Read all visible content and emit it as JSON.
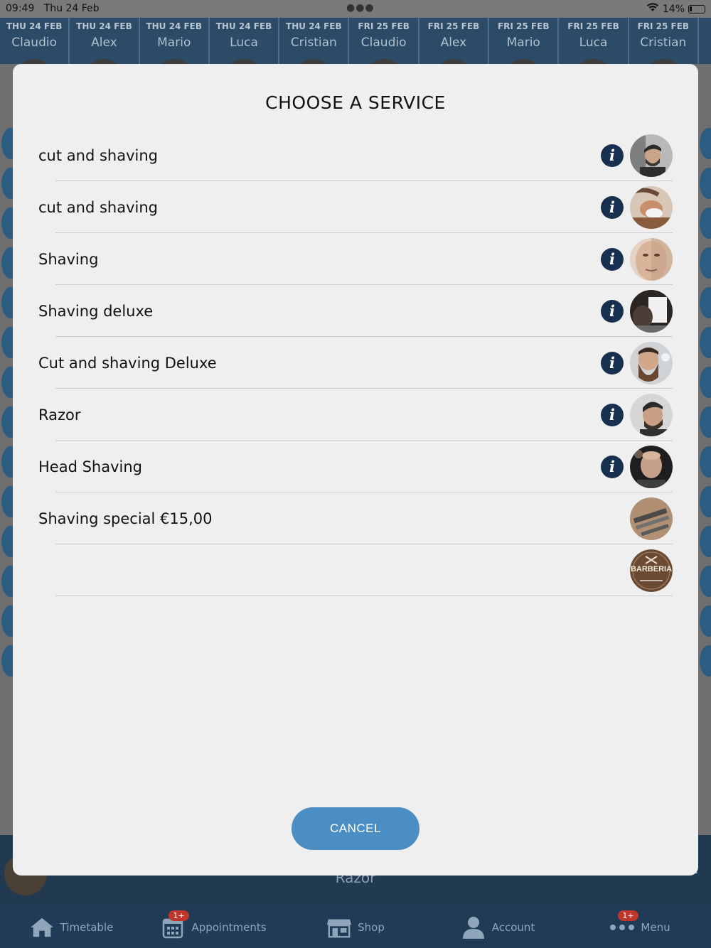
{
  "status_bar": {
    "time": "09:49",
    "date": "Thu 24 Feb",
    "battery": "14%"
  },
  "staff_header": [
    {
      "date": "THU 24 FEB",
      "name": "Claudio"
    },
    {
      "date": "THU 24 FEB",
      "name": "Alex"
    },
    {
      "date": "THU 24 FEB",
      "name": "Mario"
    },
    {
      "date": "THU 24 FEB",
      "name": "Luca"
    },
    {
      "date": "THU 24 FEB",
      "name": "Cristian"
    },
    {
      "date": "FRI 25 FEB",
      "name": "Claudio"
    },
    {
      "date": "FRI 25 FEB",
      "name": "Alex"
    },
    {
      "date": "FRI 25 FEB",
      "name": "Mario"
    },
    {
      "date": "FRI 25 FEB",
      "name": "Luca"
    },
    {
      "date": "FRI 25 FEB",
      "name": "Cristian"
    }
  ],
  "modal": {
    "title": "CHOOSE A SERVICE",
    "services": [
      {
        "label": "cut and shaving",
        "has_info": true,
        "thumb": "portrait-fade-cut"
      },
      {
        "label": "cut and shaving",
        "has_info": true,
        "thumb": "portrait-shaving-foam"
      },
      {
        "label": "Shaving",
        "has_info": true,
        "thumb": "portrait-face-closeup"
      },
      {
        "label": "Shaving deluxe",
        "has_info": true,
        "thumb": "barber-towel"
      },
      {
        "label": "Cut and shaving Deluxe",
        "has_info": true,
        "thumb": "portrait-full-beard"
      },
      {
        "label": "Razor",
        "has_info": true,
        "thumb": "portrait-side-fade"
      },
      {
        "label": "Head Shaving",
        "has_info": true,
        "thumb": "portrait-bald"
      },
      {
        "label": "Shaving special  €15,00",
        "has_info": false,
        "thumb": "razor-tools"
      },
      {
        "label": "",
        "has_info": false,
        "thumb": "barberia-logo"
      }
    ],
    "logo_text": "BARBERIA",
    "cancel_label": "CANCEL"
  },
  "behind": {
    "selected_service": "Razor"
  },
  "tabbar": [
    {
      "label": "Timetable",
      "icon": "home-icon",
      "badge": ""
    },
    {
      "label": "Appointments",
      "icon": "calendar-icon",
      "badge": "1+"
    },
    {
      "label": "Shop",
      "icon": "shop-icon",
      "badge": ""
    },
    {
      "label": "Account",
      "icon": "user-icon",
      "badge": ""
    },
    {
      "label": "Menu",
      "icon": "more-icon",
      "badge": "1+"
    }
  ],
  "colors": {
    "info_bg": "#17304f",
    "cancel_bg": "#4b8ec4",
    "header_bg": "#2c4b66",
    "tabbar_bg": "#1f3b55",
    "badge_bg": "#c0362b"
  }
}
